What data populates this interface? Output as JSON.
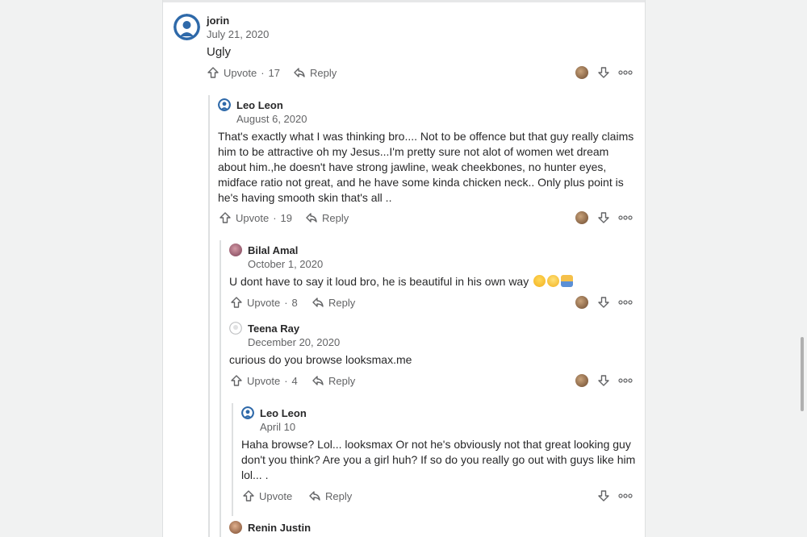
{
  "actions": {
    "upvote": "Upvote",
    "reply": "Reply"
  },
  "comments": [
    {
      "name": "jorin",
      "date": "July 21, 2020",
      "text": "Ugly",
      "upvotes": "17"
    },
    {
      "name": "Leo Leon",
      "date": "August 6, 2020",
      "text": "That's exactly what I was thinking bro.... Not to be offence but that guy really claims him to be attractive oh my Jesus...I'm pretty sure not alot of women wet dream about him.,he doesn't have strong jawline, weak cheekbones, no hunter eyes, midface ratio not great, and he have some kinda chicken neck.. Only plus point is he's having smooth skin that's all ..",
      "upvotes": "19"
    },
    {
      "name": "Bilal Amal",
      "date": "October 1, 2020",
      "text": "U dont have to say it loud bro, he is beautiful in his own way",
      "upvotes": "8"
    },
    {
      "name": "Teena Ray",
      "date": "December 20, 2020",
      "text": "curious do you browse looksmax.me",
      "upvotes": "4"
    },
    {
      "name": "Leo Leon",
      "date": "April 10",
      "text": "Haha browse? Lol... looksmax Or not he's obviously not that great looking guy don't you think? Are you a girl huh? If so do you really go out with guys like him lol... .",
      "upvotes": ""
    },
    {
      "name": "Renin Justin"
    }
  ],
  "colors": {
    "text": "#282829",
    "secondary": "#636466",
    "background": "#f1f2f2",
    "avatar_blue": "#2e69a9"
  }
}
